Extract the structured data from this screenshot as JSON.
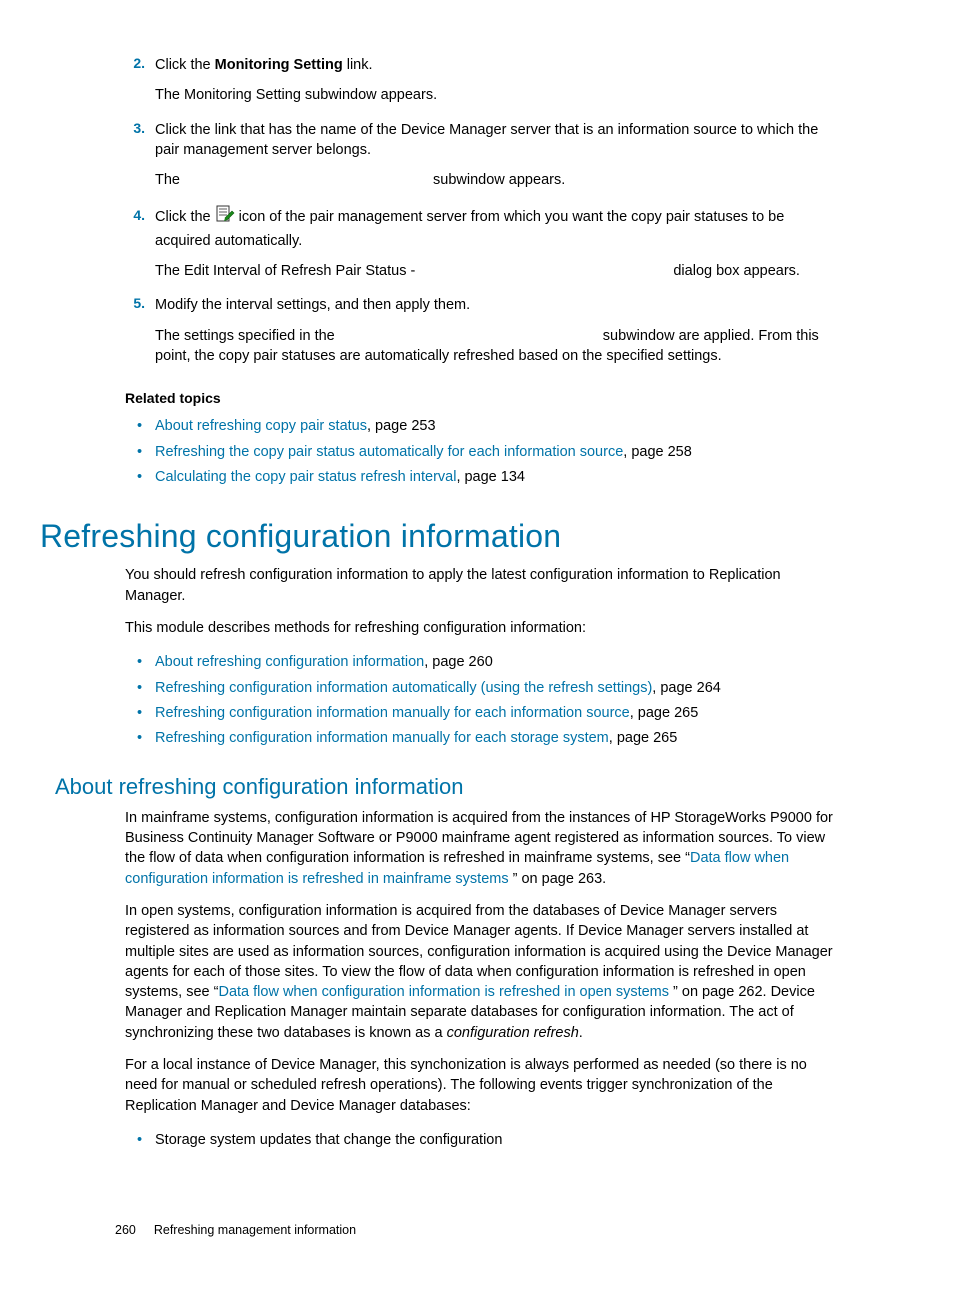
{
  "steps": [
    {
      "num": "2.",
      "line1_pre": "Click the ",
      "line1_bold": "Monitoring Setting",
      "line1_post": " link.",
      "line2": "The Monitoring Setting subwindow appears."
    },
    {
      "num": "3.",
      "line1": "Click the link that has the name of the Device Manager server that is an information source to which the pair management server belongs.",
      "line2_pre": "The ",
      "line2_post": " subwindow appears."
    },
    {
      "num": "4.",
      "line1_pre": "Click the ",
      "line1_post": " icon of the pair management server from which you want the copy pair statuses to be acquired automatically.",
      "line2_pre": "The Edit Interval of Refresh Pair Status - ",
      "line2_post": " dialog box appears."
    },
    {
      "num": "5.",
      "line1": "Modify the interval settings, and then apply them.",
      "line2_pre": "The settings specified in the ",
      "line2_mid": " subwindow are applied. From this point, the copy pair statuses are automatically refreshed based on the specified settings."
    }
  ],
  "related": {
    "heading": "Related topics",
    "items": [
      {
        "text": "About refreshing copy pair status",
        "suffix": ", page 253"
      },
      {
        "text": "Refreshing the copy pair status automatically for each information source",
        "suffix": ", page 258"
      },
      {
        "text": "Calculating the copy pair status refresh interval",
        "suffix": ", page 134"
      }
    ]
  },
  "h1": "Refreshing configuration information",
  "intro1": "You should refresh configuration information to apply the latest configuration information to Replication Manager.",
  "intro2": "This module describes methods for refreshing configuration information:",
  "toc": [
    {
      "text": "About refreshing configuration information",
      "suffix": ", page 260"
    },
    {
      "text": "Refreshing configuration information automatically (using the refresh settings)",
      "suffix": ", page 264"
    },
    {
      "text": "Refreshing configuration information manually for each information source",
      "suffix": ", page 265"
    },
    {
      "text": "Refreshing configuration information manually for each storage system",
      "suffix": ", page 265"
    }
  ],
  "h2": "About refreshing configuration information",
  "para1_pre": "In mainframe systems, configuration information is acquired from the instances of HP StorageWorks P9000 for Business Continuity Manager Software or P9000 mainframe agent registered as information sources. To view the flow of data when configuration information is refreshed in mainframe systems, see “",
  "para1_link": "Data flow when configuration information is refreshed in mainframe systems ",
  "para1_post": "” on page 263.",
  "para2_pre": "In open systems, configuration information is acquired from the databases of Device Manager servers registered as information sources and from Device Manager agents. If Device Manager servers installed at multiple sites are used as information sources, configuration information is acquired using the Device Manager agents for each of those sites. To view the flow of data when configuration information is refreshed in open systems, see “",
  "para2_link": "Data flow when configuration information is refreshed in open systems  ",
  "para2_post_a": "” on page 262. Device Manager and Replication Manager maintain separate databases for configuration information. The act of synchronizing these two databases is known as a ",
  "para2_italic": "configuration refresh",
  "para2_post_b": ".",
  "para3": "For a local instance of Device Manager, this synchonization is always performed as needed (so there is no need for manual or scheduled refresh operations). The following events trigger synchronization of the Replication Manager and Device Manager databases:",
  "trigger1": "Storage system updates that change the configuration",
  "footer": {
    "page": "260",
    "chapter": "Refreshing management information"
  }
}
